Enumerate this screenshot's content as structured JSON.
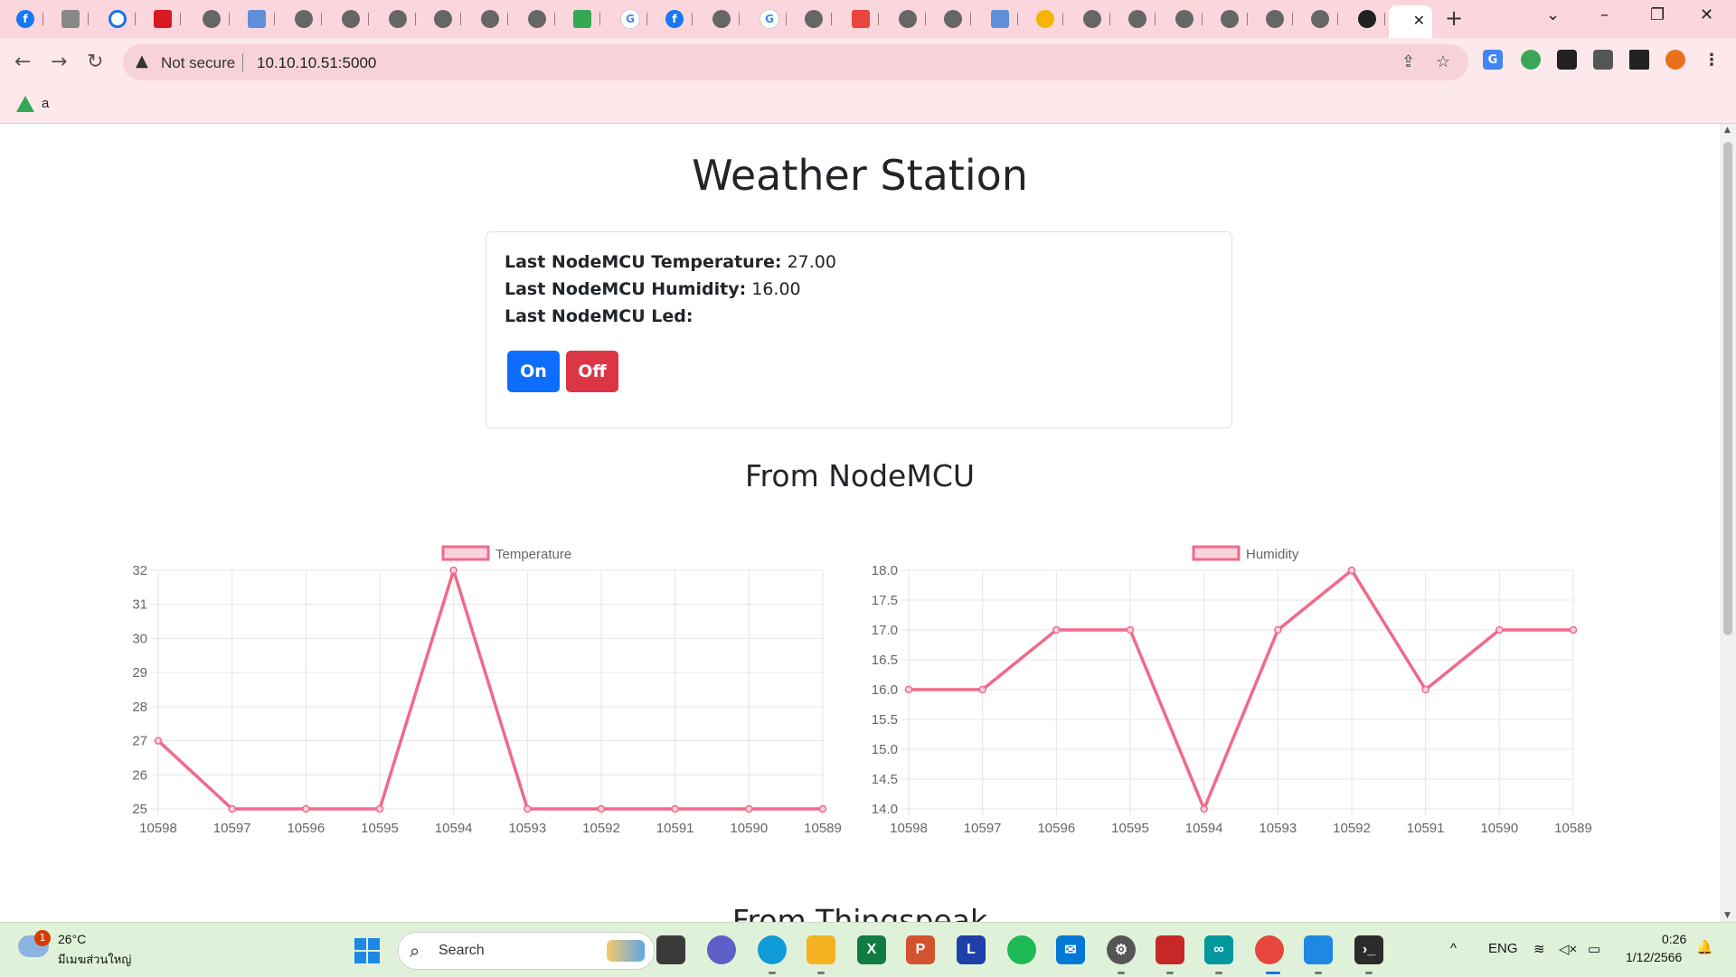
{
  "browser": {
    "security_label": "Not secure",
    "url": "10.10.10.51:5000",
    "bookmark_label": "a"
  },
  "page": {
    "title": "Weather Station",
    "readings": {
      "temp_label": "Last NodeMCU Temperature:",
      "temp_value": "27.00",
      "hum_label": "Last NodeMCU Humidity:",
      "hum_value": "16.00",
      "led_label": "Last NodeMCU Led:",
      "led_value": ""
    },
    "buttons": {
      "on": "On",
      "off": "Off"
    },
    "section_title": "From NodeMCU",
    "next_section_partial": "From Thingspeak"
  },
  "chart_data": [
    {
      "type": "line",
      "legend": "Temperature",
      "x": [
        "10598",
        "10597",
        "10596",
        "10595",
        "10594",
        "10593",
        "10592",
        "10591",
        "10590",
        "10589"
      ],
      "values": [
        27,
        25,
        25,
        25,
        32,
        25,
        25,
        25,
        25,
        25
      ],
      "ylim": [
        25,
        32
      ],
      "yticks": [
        25,
        26,
        27,
        28,
        29,
        30,
        31,
        32
      ],
      "color": "#f06a8a",
      "grid": true,
      "legend_position": "top"
    },
    {
      "type": "line",
      "legend": "Humidity",
      "x": [
        "10598",
        "10597",
        "10596",
        "10595",
        "10594",
        "10593",
        "10592",
        "10591",
        "10590",
        "10589"
      ],
      "values": [
        16,
        16,
        17,
        17,
        14,
        17,
        18,
        16,
        17,
        17
      ],
      "ylim": [
        14,
        18
      ],
      "yticks": [
        "14.0",
        "14.5",
        "15.0",
        "15.5",
        "16.0",
        "16.5",
        "17.0",
        "17.5",
        "18.0"
      ],
      "color": "#f06a8a",
      "grid": true,
      "legend_position": "top"
    }
  ],
  "taskbar": {
    "weather_temp": "26°C",
    "weather_location": "มีเมฆส่วนใหญ่",
    "weather_badge": "1",
    "search_label": "Search",
    "language": "ENG",
    "time": "0:26",
    "date": "1/12/2566"
  }
}
